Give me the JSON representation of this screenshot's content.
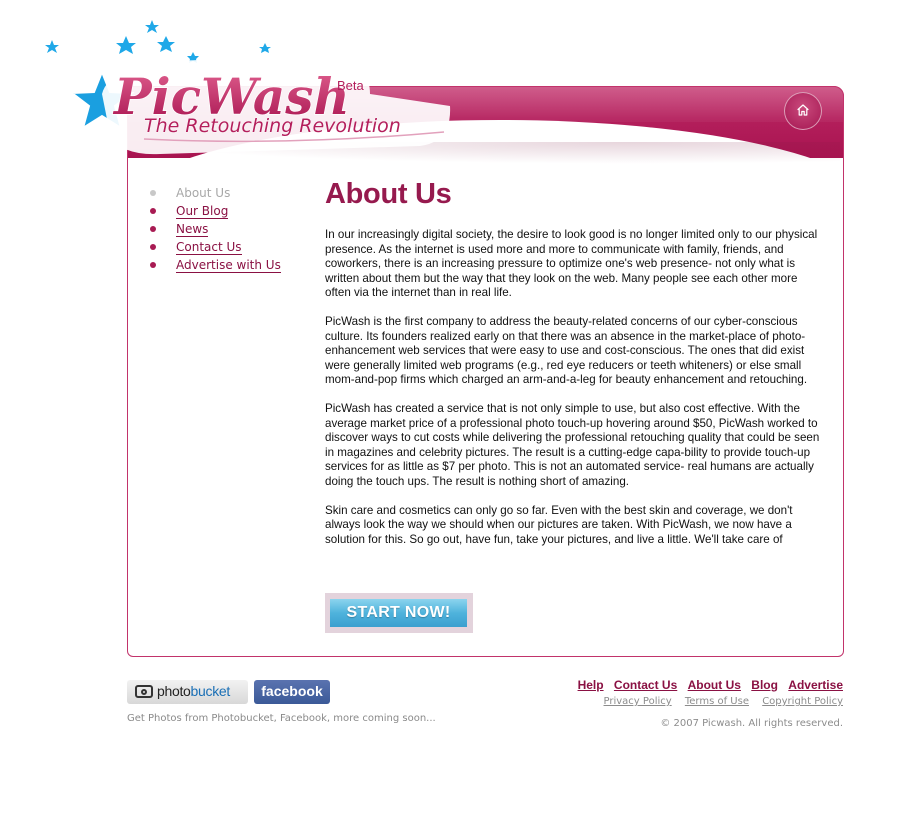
{
  "brand": {
    "name": "PicWash",
    "badge": "Beta",
    "tagline": "The Retouching Revolution"
  },
  "colors": {
    "brand_magenta": "#b41f5c",
    "link": "#8a1143",
    "heading": "#961a4e",
    "button_blue": "#4fb3dc",
    "star_blue": "#1fa8e8"
  },
  "header": {
    "home_icon": "home-icon"
  },
  "nav": {
    "items": [
      {
        "label": "About Us",
        "active": true
      },
      {
        "label": "Our Blog",
        "active": false
      },
      {
        "label": "News",
        "active": false
      },
      {
        "label": "Contact Us",
        "active": false
      },
      {
        "label": "Advertise with Us",
        "active": false
      }
    ]
  },
  "main": {
    "title": "About Us",
    "paragraphs": [
      "In our increasingly digital society, the desire to look good is no longer limited only to our physical presence. As the internet is used more and more to communicate with family, friends, and coworkers, there is an increasing pressure to optimize one's web presence- not only what is written about them but the way that they look on the web. Many people see each other more often via the internet than in real life.",
      "PicWash is the first company to address the beauty-related concerns of our cyber-conscious culture. Its founders realized early on that there was an absence in the market-place of photo-enhancement web services that were easy to use and cost-conscious. The ones that did exist were generally limited web programs (e.g., red eye reducers or teeth whiteners) or else small mom-and-pop firms which charged an arm-and-a-leg for beauty enhancement and retouching.",
      "PicWash has created a service that is not only simple to use, but also cost effective. With the average market price of a professional photo touch-up hovering around $50, PicWash worked to discover ways to cut costs while delivering the professional retouching quality that could be seen in magazines and celebrity pictures. The result is a cutting-edge capa-bility to provide touch-up services for as little as $7 per photo. This is not an automated service- real humans are actually doing the touch ups. The result is nothing short of amazing.",
      "Skin care and cosmetics can only go so far. Even with the best skin and coverage, we don't always look the way we should when our pictures are taken. With PicWash, we now have a solution for this. So go out, have fun, take your pictures, and live a little. We'll take care of"
    ],
    "cta_label": "START NOW!"
  },
  "footer": {
    "partners": {
      "photobucket_prefix": "photo",
      "photobucket_suffix": "bucket",
      "facebook": "facebook"
    },
    "note": "Get Photos from Photobucket, Facebook, more coming soon...",
    "links": [
      "Help",
      "Contact Us",
      "About Us",
      "Blog",
      "Advertise"
    ],
    "legal": [
      "Privacy Policy",
      "Terms of Use",
      "Copyright Policy"
    ],
    "copyright": "© 2007 Picwash. All rights reserved."
  }
}
